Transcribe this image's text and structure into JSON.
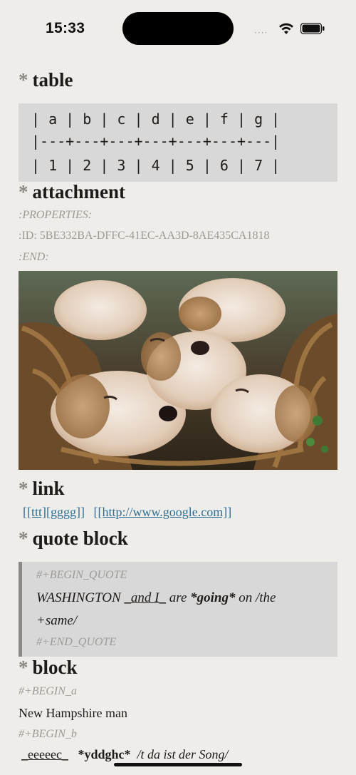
{
  "status_bar": {
    "time": "15:33",
    "signal_dots": "····"
  },
  "sections": {
    "table": {
      "star": "*",
      "heading": "table",
      "lines": [
        "| a | b | c | d | e | f | g |",
        "|---+---+---+---+---+---+---|",
        "| 1 | 2 | 3 | 4 | 5 | 6 | 7 |"
      ]
    },
    "attachment": {
      "star": "*",
      "heading": "attachment",
      "properties_begin": ":PROPERTIES:",
      "id_line": ":ID: 5BE332BA-DFFC-41EC-AA3D-8AE435CA1818",
      "properties_end": ":END:"
    },
    "link": {
      "star": "*",
      "heading": "link",
      "links": [
        "[[ttt][gggg]]",
        "[[http://www.google.com]]"
      ]
    },
    "quote": {
      "star": "*",
      "heading": "quote block",
      "begin": "#+BEGIN_QUOTE",
      "text_part1": "WASHINGTON ",
      "text_part2": "_and I_",
      "text_part3": " are ",
      "text_part4": "*going*",
      "text_part5": " on /the",
      "text_line2": "+same/",
      "end": "#+END_QUOTE"
    },
    "block": {
      "star": "*",
      "heading": "block",
      "begin_a": "#+BEGIN_a",
      "text_a": "New Hampshire man",
      "begin_b": "#+BEGIN_b",
      "last_part1": "_eeeeec_",
      "last_part2": "*yddghc*",
      "last_part3": "/t da ist der Song/"
    }
  },
  "colors": {
    "background": "#efedea",
    "code_bg": "#d8d8d8",
    "link": "#2f6f93",
    "meta": "#9d9a96"
  }
}
